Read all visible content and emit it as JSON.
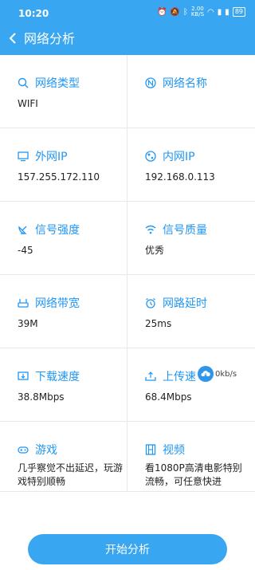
{
  "status_bar": {
    "time": "10:20",
    "net_speed_value": "2.00",
    "net_speed_unit": "KB/S",
    "battery": "89"
  },
  "header": {
    "title": "网络分析"
  },
  "cells": {
    "network_type": {
      "label": "网络类型",
      "value": "WIFI"
    },
    "network_name": {
      "label": "网络名称",
      "value": ""
    },
    "external_ip": {
      "label": "外网IP",
      "value": "157.255.172.110"
    },
    "internal_ip": {
      "label": "内网IP",
      "value": "192.168.0.113"
    },
    "signal_strength": {
      "label": "信号强度",
      "value": "-45"
    },
    "signal_quality": {
      "label": "信号质量",
      "value": "优秀"
    },
    "bandwidth": {
      "label": "网络带宽",
      "value": "39M"
    },
    "latency": {
      "label": "网路延时",
      "value": "25ms"
    },
    "download_speed": {
      "label": "下载速度",
      "value": "38.8Mbps"
    },
    "upload_speed": {
      "label": "上传速",
      "value": "68.4Mbps",
      "overlay": "0kb/s"
    },
    "game": {
      "label": "游戏",
      "value": "几乎察觉不出延迟，玩游戏特别顺畅"
    },
    "video": {
      "label": "视频",
      "value": "看1080P高清电影特别流畅，可任意快进"
    }
  },
  "start_button": {
    "label": "开始分析"
  },
  "colors": {
    "accent": "#39a6f2",
    "label": "#2196f3"
  }
}
